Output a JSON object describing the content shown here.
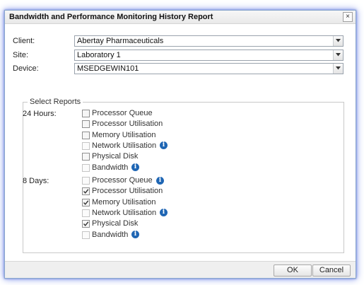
{
  "dialog": {
    "title": "Bandwidth and Performance Monitoring History Report",
    "close_glyph": "×"
  },
  "fields": {
    "client": {
      "label": "Client:",
      "value": "Abertay Pharmaceuticals"
    },
    "site": {
      "label": "Site:",
      "value": "Laboratory 1"
    },
    "device": {
      "label": "Device:",
      "value": "MSEDGEWIN101"
    }
  },
  "reports": {
    "legend": "Select Reports",
    "groups": [
      {
        "label": "24 Hours:",
        "items": [
          {
            "label": "Processor Queue",
            "checked": false,
            "enabled": true,
            "info": false
          },
          {
            "label": "Processor Utilisation",
            "checked": false,
            "enabled": true,
            "info": false
          },
          {
            "label": "Memory Utilisation",
            "checked": false,
            "enabled": true,
            "info": false
          },
          {
            "label": "Network Utilisation",
            "checked": false,
            "enabled": false,
            "info": true
          },
          {
            "label": "Physical Disk",
            "checked": false,
            "enabled": true,
            "info": false
          },
          {
            "label": "Bandwidth",
            "checked": false,
            "enabled": false,
            "info": true
          }
        ]
      },
      {
        "label": "8 Days:",
        "items": [
          {
            "label": "Processor Queue",
            "checked": false,
            "enabled": false,
            "info": true
          },
          {
            "label": "Processor Utilisation",
            "checked": true,
            "enabled": true,
            "info": false
          },
          {
            "label": "Memory Utilisation",
            "checked": true,
            "enabled": true,
            "info": false
          },
          {
            "label": "Network Utilisation",
            "checked": false,
            "enabled": false,
            "info": true
          },
          {
            "label": "Physical Disk",
            "checked": true,
            "enabled": true,
            "info": false
          },
          {
            "label": "Bandwidth",
            "checked": false,
            "enabled": false,
            "info": true
          }
        ]
      }
    ]
  },
  "buttons": {
    "ok": "OK",
    "cancel": "Cancel"
  },
  "icons": {
    "info": "info-icon",
    "dropdown": "chevron-down-icon",
    "check": "check-icon"
  },
  "colors": {
    "info_blue": "#1f66b4",
    "dialog_glow": "#7c90e8"
  }
}
